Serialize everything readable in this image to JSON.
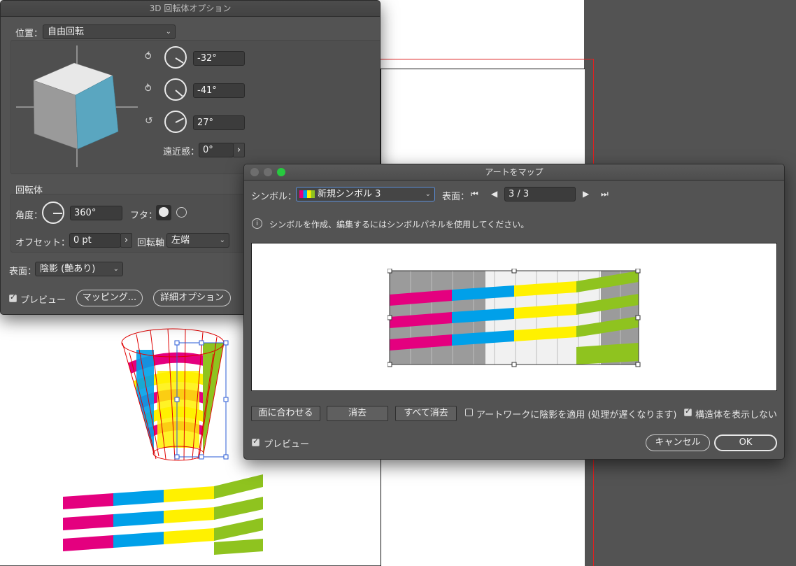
{
  "dialog3d": {
    "title": "3D 回転体オプション",
    "position_label": "位置：",
    "position_value": "自由回転",
    "rot_x": "-32°",
    "rot_y": "-41°",
    "rot_z": "27°",
    "perspective_label": "遠近感：",
    "perspective_value": "0°",
    "revolve_section": "回転体",
    "angle_label": "角度：",
    "angle_value": "360°",
    "cap_label": "フタ：",
    "offset_label": "オフセット：",
    "offset_value": "0 pt",
    "axis_label": "回転軸",
    "axis_value": "左端",
    "surface_label": "表面：",
    "surface_value": "陰影 (艶あり)",
    "preview_label": "プレビュー",
    "mapping_button": "マッピング...",
    "more_options_button": "詳細オプション"
  },
  "dialogMap": {
    "title": "アートをマップ",
    "symbol_label": "シンボル：",
    "symbol_value": "新規シンボル 3",
    "surface_label": "表面：",
    "surface_value": "3 / 3",
    "info_text": "シンボルを作成、編集するにはシンボルパネルを使用してください。",
    "info_icon_glyph": "i",
    "fit_button": "面に合わせる",
    "clear_button": "消去",
    "clear_all_button": "すべて消去",
    "shade_artwork_label": "アートワークに陰影を適用 (処理が遅くなります)",
    "shade_artwork_checked": false,
    "hide_geometry_label": "構造体を表示しない",
    "hide_geometry_checked": true,
    "preview_label": "プレビュー",
    "preview_checked": true,
    "cancel_button": "キャンセル",
    "ok_button": "OK"
  },
  "colors": {
    "magenta": "#e4007f",
    "cyan": "#00a0e9",
    "yellow": "#fff100",
    "green": "#8fc31f",
    "cube_side": "#5aa6c0",
    "selection": "#2a5bd7",
    "mesh": "#e00000"
  }
}
